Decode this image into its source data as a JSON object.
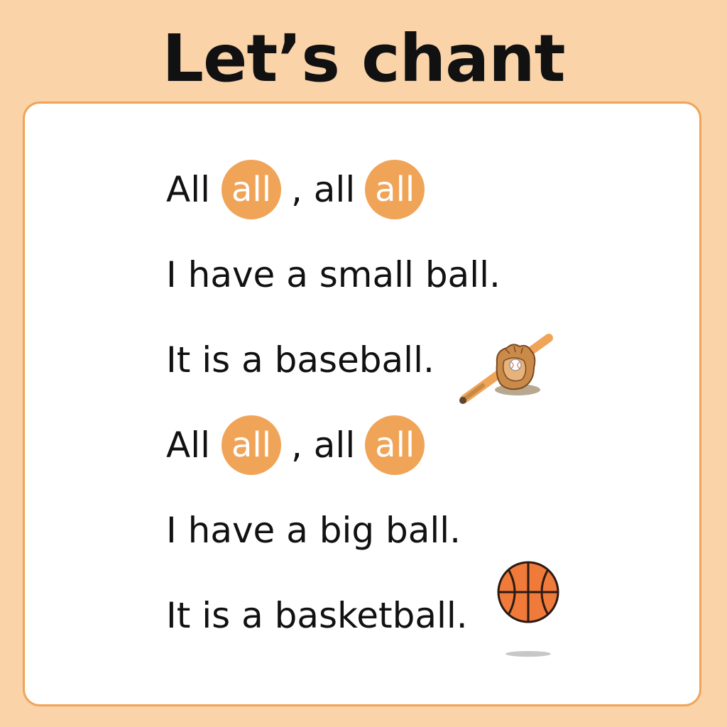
{
  "title": "Let’s chant",
  "verses": [
    {
      "lead": "All",
      "pill1": "all",
      "mid": ", all",
      "pill2": "all"
    },
    {
      "text": "I have a small ball."
    },
    {
      "text": "It is a baseball."
    },
    {
      "lead": "All",
      "pill1": "all",
      "mid": ", all",
      "pill2": "all"
    },
    {
      "text": "I have a big ball."
    },
    {
      "text": "It is a basketball."
    }
  ],
  "colors": {
    "background": "#fad3a9",
    "accent": "#f0a458",
    "card": "#ffffff",
    "text": "#111111"
  },
  "icons": [
    "baseball-bat-glove-icon",
    "basketball-icon"
  ]
}
